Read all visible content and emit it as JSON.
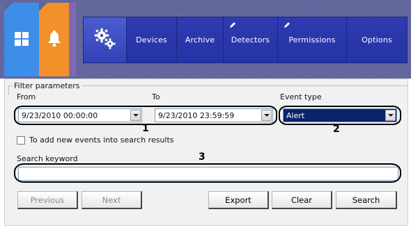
{
  "nav": {
    "tiles": [
      {
        "icon": "windows-grid-icon",
        "color": "#3d8ee8"
      },
      {
        "icon": "bell-icon",
        "color": "#f4902a"
      }
    ],
    "menu": [
      {
        "label": "Devices",
        "editable": false
      },
      {
        "label": "Archive",
        "editable": false
      },
      {
        "label": "Detectors",
        "editable": true
      },
      {
        "label": "Permissions",
        "editable": true
      },
      {
        "label": "Options",
        "editable": false
      }
    ],
    "settings_icon": "gears-icon"
  },
  "filter": {
    "legend": "Filter parameters",
    "from_label": "From",
    "to_label": "To",
    "event_type_label": "Event type",
    "from_value": "9/23/2010 00:00:00",
    "to_value": "9/23/2010 23:59:59",
    "event_type_value": "Alert",
    "checkbox_label": "To add new events into search results",
    "checkbox_checked": false,
    "keyword_label": "Search keyword",
    "keyword_value": ""
  },
  "callouts": [
    "1",
    "2",
    "3"
  ],
  "buttons": {
    "previous": "Previous",
    "next": "Next",
    "export": "Export",
    "clear": "Clear",
    "search": "Search"
  },
  "colors": {
    "banner": "#5f6399",
    "menu": "#2f3bb1",
    "selected": "#0a246a"
  }
}
